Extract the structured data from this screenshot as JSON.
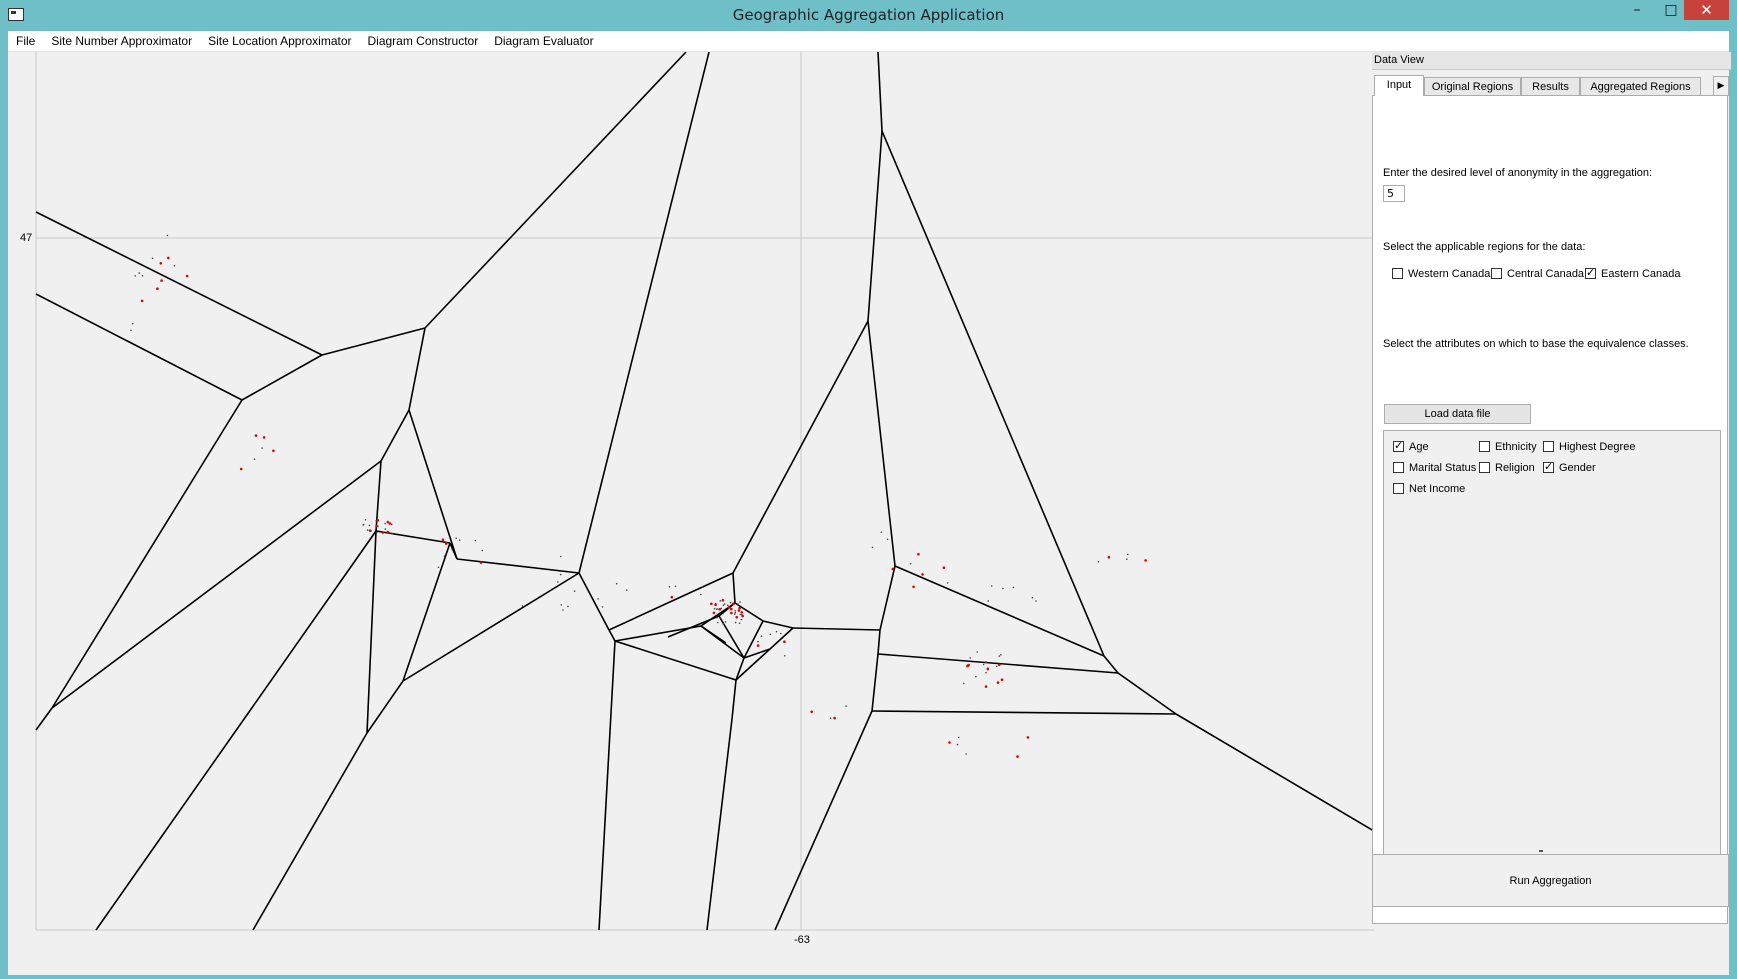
{
  "window": {
    "title": "Geographic Aggregation Application",
    "min": "–",
    "max": "□",
    "close": "✕"
  },
  "menu": [
    {
      "label": "File"
    },
    {
      "label": "Site Number Approximator"
    },
    {
      "label": "Site Location Approximator"
    },
    {
      "label": "Diagram Constructor"
    },
    {
      "label": "Diagram Evaluator"
    }
  ],
  "plot": {
    "y_axis_label": "47",
    "x_axis_label": "-63"
  },
  "data_view": {
    "title": "Data View",
    "tabs": [
      "Input",
      "Original Regions",
      "Results",
      "Aggregated Regions"
    ],
    "tab_scroll": "▶",
    "input": {
      "anonymity_prompt": "Enter the desired level of anonymity in the aggregation:",
      "anonymity_value": "5",
      "regions_prompt": "Select the applicable regions for the data:",
      "regions": [
        {
          "label": "Western Canada",
          "checked": false
        },
        {
          "label": "Central Canada",
          "checked": false
        },
        {
          "label": "Eastern Canada",
          "checked": true
        }
      ],
      "attributes_prompt": "Select the attributes on which to base the equivalence classes.",
      "load_button": "Load data file",
      "attributes": [
        {
          "label": "Age",
          "checked": true
        },
        {
          "label": "Ethnicity",
          "checked": false
        },
        {
          "label": "Highest Degree",
          "checked": false
        },
        {
          "label": "Marital Status",
          "checked": false
        },
        {
          "label": "Religion",
          "checked": false
        },
        {
          "label": "Gender",
          "checked": true
        },
        {
          "label": "Net Income",
          "checked": false
        }
      ]
    },
    "run_button": "Run Aggregation"
  }
}
